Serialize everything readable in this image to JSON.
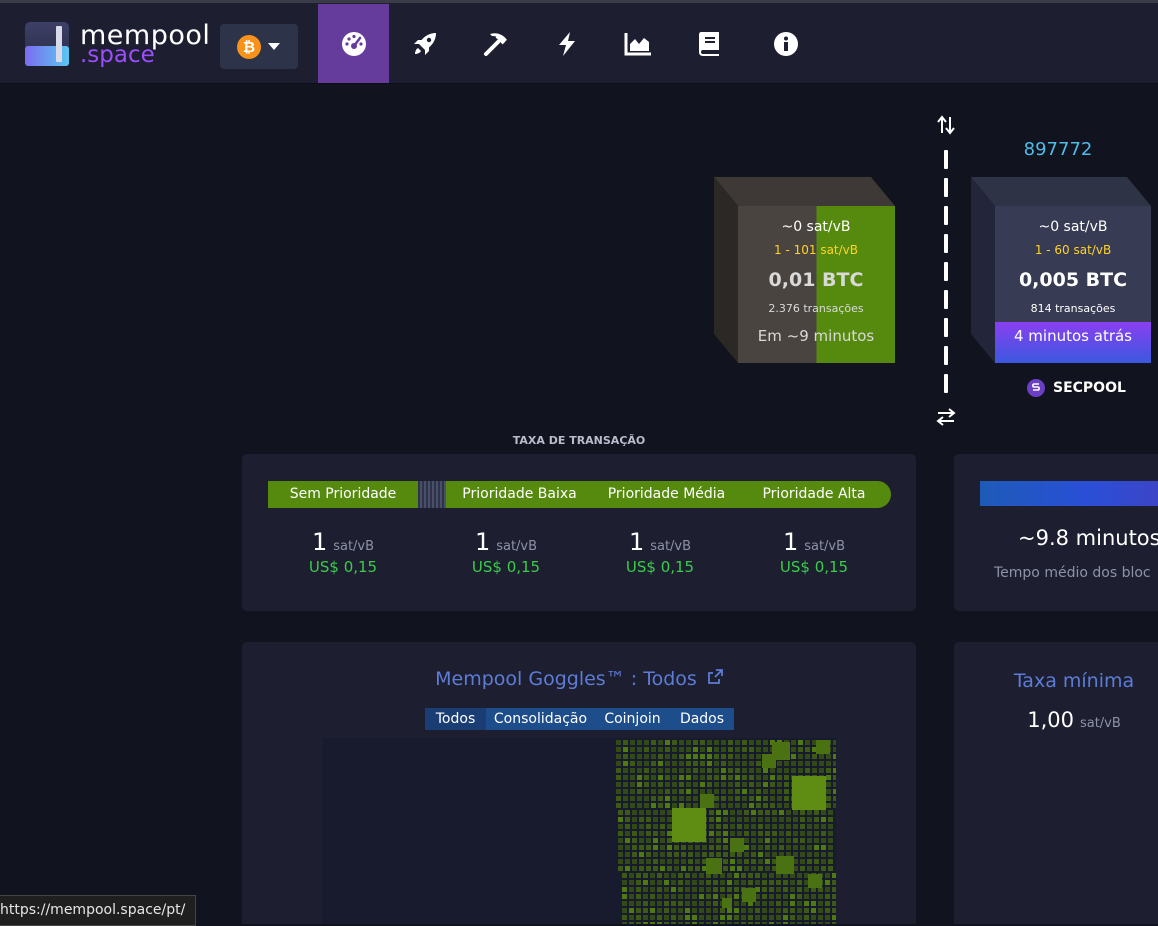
{
  "logo": {
    "line1": "mempool",
    "line2": ".space"
  },
  "nav": {
    "network": "bitcoin",
    "items": [
      {
        "name": "dashboard",
        "icon": "tachometer-icon",
        "active": true
      },
      {
        "name": "accelerate",
        "icon": "rocket-icon",
        "active": false
      },
      {
        "name": "mining",
        "icon": "pickaxe-icon",
        "active": false
      },
      {
        "name": "lightning",
        "icon": "bolt-icon",
        "active": false
      },
      {
        "name": "graphs",
        "icon": "area-chart-icon",
        "active": false
      },
      {
        "name": "docs",
        "icon": "book-icon",
        "active": false
      },
      {
        "name": "about",
        "icon": "info-circle-icon",
        "active": false
      }
    ]
  },
  "mempool_block": {
    "median_fee": "~0 sat/vB",
    "fee_range": "1 - 101 sat/vB",
    "total": "0,01 BTC",
    "tx_count": "2.376 transações",
    "eta": "Em ~9 minutos",
    "fill_fraction": 0.5
  },
  "mined_block": {
    "height": "897772",
    "median_fee": "~0 sat/vB",
    "fee_range": "1 - 60 sat/vB",
    "total": "0,005 BTC",
    "tx_count": "814 transações",
    "time_ago": "4 minutos atrás",
    "pool": "SECPOOL"
  },
  "fees": {
    "heading": "TAXA DE TRANSAÇÃO",
    "labels": [
      "Sem Prioridade",
      "Prioridade Baixa",
      "Prioridade Média",
      "Prioridade Alta"
    ],
    "values": [
      {
        "value": "1",
        "unit": "sat/vB",
        "usd": "US$ 0,15"
      },
      {
        "value": "1",
        "unit": "sat/vB",
        "usd": "US$ 0,15"
      },
      {
        "value": "1",
        "unit": "sat/vB",
        "usd": "US$ 0,15"
      },
      {
        "value": "1",
        "unit": "sat/vB",
        "usd": "US$ 0,15"
      }
    ]
  },
  "difficulty": {
    "value": "~9.8 minutos",
    "label": "Tempo médio dos bloc"
  },
  "goggles": {
    "title": "Mempool Goggles™ : Todos",
    "filters": [
      "Todos",
      "Consolidação",
      "Coinjoin",
      "Dados"
    ]
  },
  "min_fee": {
    "title": "Taxa mínima",
    "value": "1,00",
    "unit": "sat/vB"
  },
  "status_url": "https://mempool.space/pt/",
  "colors": {
    "nav_bg": "#1d1f31",
    "active": "#653b9c",
    "fee_green": "#3bcc49",
    "link_blue": "#4fbcea",
    "bar_green": "#568a0f"
  }
}
